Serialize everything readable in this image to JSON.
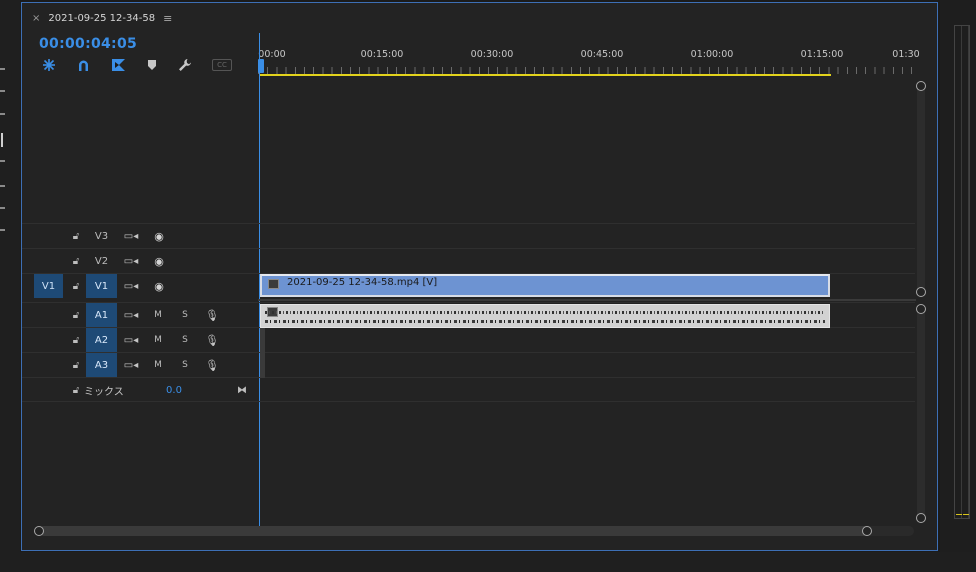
{
  "panel": {
    "close_glyph": "×",
    "sequence_name": "2021-09-25 12-34-58",
    "menu_glyph": "≡"
  },
  "timecode": "00:00:04:05",
  "toolbar": {
    "icons": [
      "snap-icon",
      "magnet-link-icon",
      "linked-selection-icon",
      "marker-icon",
      "wrench-settings-icon",
      "closed-captions-icon"
    ],
    "cc_label": "CC"
  },
  "ruler": {
    "labels": [
      "00:00",
      "00:15:00",
      "00:30:00",
      "00:45:00",
      "01:00:00",
      "01:15:00",
      "01:30"
    ]
  },
  "tracks": {
    "video": [
      {
        "id": "V3",
        "label": "V3",
        "targeted": false
      },
      {
        "id": "V2",
        "label": "V2",
        "targeted": false
      },
      {
        "id": "V1",
        "label": "V1",
        "targeted": true,
        "source_patch": "V1"
      }
    ],
    "audio": [
      {
        "id": "A1",
        "label": "A1",
        "mute": "M",
        "solo": "S"
      },
      {
        "id": "A2",
        "label": "A2",
        "mute": "M",
        "solo": "S"
      },
      {
        "id": "A3",
        "label": "A3",
        "mute": "M",
        "solo": "S"
      }
    ],
    "mix": {
      "label": "ミックス",
      "value": "0.0"
    }
  },
  "clips": {
    "video_clip_name": "2021-09-25 12-34-58.mp4 [V]"
  },
  "colors": {
    "accent": "#3a8ee6",
    "track_target": "#1e4a76",
    "video_clip": "#6d93d2",
    "audio_clip": "#d2d2d2",
    "work_area": "#e2d21c"
  }
}
